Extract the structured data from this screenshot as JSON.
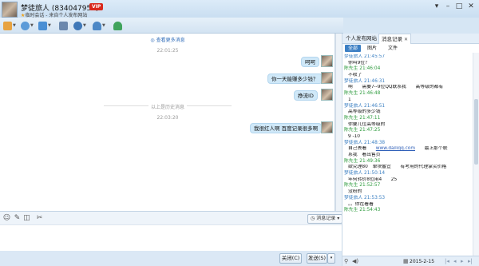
{
  "titlebar": {
    "contact_name": "梦徒旅人 (834047951)",
    "vip_badge": "VIP",
    "session_info": "临时会话 - 来自个人发布网站"
  },
  "chat": {
    "more_messages": "查看更多消息",
    "timestamp1": "22:01:25",
    "history_separator": "以上是历史消息",
    "timestamp2": "22:03:20",
    "messages": [
      {
        "text": "呵呵"
      },
      {
        "text": "你一天能赚多少钱？"
      },
      {
        "text": "挣流ID"
      },
      {
        "text": "我很红人啊 百度记录很多啊"
      }
    ]
  },
  "input": {
    "history_button": "消息记录"
  },
  "buttons": {
    "close": "关闭(C)",
    "send": "发送(S)"
  },
  "right_panel": {
    "tabs": [
      "个人发布网站",
      "消息记录"
    ],
    "subtabs": [
      "全部",
      "图片",
      "文件"
    ],
    "records": [
      {
        "sender": "梦徒旅人",
        "time": "21:45:57",
        "lines": [
          "你叫9位？"
        ]
      },
      {
        "sender": "陈先生",
        "time": "21:46:04",
        "lines": [
          "不收了"
        ]
      },
      {
        "sender": "梦徒旅人",
        "time": "21:46:31",
        "lines": [
          "啊　　需要7--9位QQ联系我　　高等级的都有"
        ]
      },
      {
        "sender": "陈先生",
        "time": "21:46:48",
        "lines": [
          "1"
        ]
      },
      {
        "sender": "梦徒旅人",
        "time": "21:46:51",
        "lines": [
          "高等级的多少钱"
        ]
      },
      {
        "sender": "陈先生",
        "time": "21:47:11",
        "lines": [
          "你要几位高等级的"
        ]
      },
      {
        "sender": "陈先生",
        "time": "21:47:25",
        "lines": [
          "9 -10"
        ]
      },
      {
        "sender": "梦徒旅人",
        "time": "21:48:38",
        "lines": [
          "自己去看　　www.dailiqq.com　　最上那个联",
          "系我　看出售页"
        ]
      },
      {
        "sender": "陈先生",
        "time": "21:49:36",
        "lines": [
          "欲究理80　单块番宜　　有考用的代理掌买价格"
        ]
      },
      {
        "sender": "梦徒旅人",
        "time": "21:50:14",
        "lines": [
          "年何转价8位用4　　25"
        ]
      },
      {
        "sender": "陈先生",
        "time": "21:52:57",
        "lines": [
          "没纷的"
        ]
      },
      {
        "sender": "梦徒旅人",
        "time": "21:53:53",
        "lines": [
          "。。你在看看"
        ]
      },
      {
        "sender": "陈先生",
        "time": "21:54:43",
        "lines": [
          ""
        ]
      }
    ],
    "footer_date": "2015-2-15"
  }
}
